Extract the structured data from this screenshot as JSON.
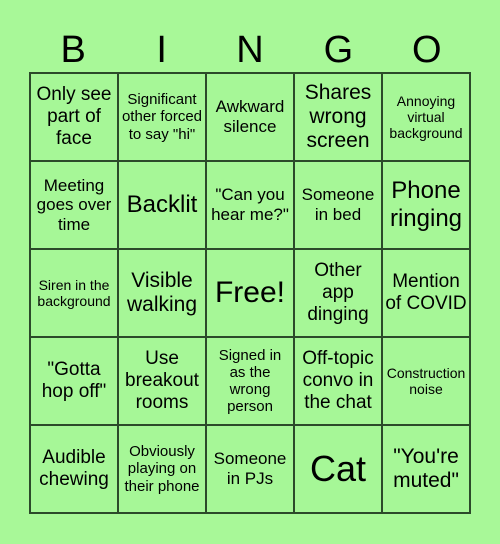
{
  "header": [
    "B",
    "I",
    "N",
    "G",
    "O"
  ],
  "cells": [
    "Only see part of face",
    "Significant other forced to say \"hi\"",
    "Awkward silence",
    "Shares wrong screen",
    "Annoying virtual background",
    "Meeting goes over time",
    "Backlit",
    "\"Can you hear me?\"",
    "Someone in bed",
    "Phone ringing",
    "Siren in the background",
    "Visible walking",
    "Free!",
    "Other app dinging",
    "Mention of COVID",
    "\"Gotta hop off\"",
    "Use breakout rooms",
    "Signed in as the wrong person",
    "Off-topic convo in the chat",
    "Construction noise",
    "Audible chewing",
    "Obviously playing on their phone",
    "Someone in PJs",
    "Cat",
    "\"You're muted\""
  ],
  "colors": {
    "background": "#a8f898",
    "border": "#2c4a2a"
  }
}
